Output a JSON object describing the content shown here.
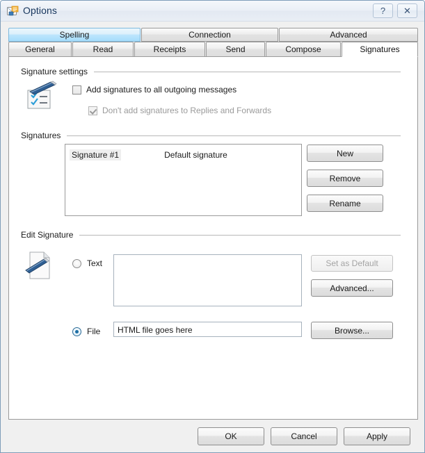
{
  "window": {
    "title": "Options",
    "icon": "mail-options-icon",
    "help_button": "?",
    "close_button": "✕"
  },
  "tabs": {
    "row1": [
      {
        "label": "Spelling",
        "state": "hover"
      },
      {
        "label": "Connection",
        "state": "normal"
      },
      {
        "label": "Advanced",
        "state": "normal"
      }
    ],
    "row2": [
      {
        "label": "General",
        "state": "normal"
      },
      {
        "label": "Read",
        "state": "normal"
      },
      {
        "label": "Receipts",
        "state": "normal"
      },
      {
        "label": "Send",
        "state": "normal"
      },
      {
        "label": "Compose",
        "state": "normal"
      },
      {
        "label": "Signatures",
        "state": "active"
      }
    ]
  },
  "signature_settings": {
    "group_label": "Signature settings",
    "icon": "signature-pen-card-icon",
    "add_to_all": {
      "label": "Add signatures to all outgoing messages",
      "checked": false,
      "enabled": true
    },
    "dont_add_replies": {
      "label": "Don't add signatures to Replies and Forwards",
      "checked": true,
      "enabled": false
    }
  },
  "signatures": {
    "group_label": "Signatures",
    "items": [
      {
        "name": "Signature #1",
        "meta": "Default signature",
        "selected": true
      }
    ],
    "buttons": {
      "new": "New",
      "remove": "Remove",
      "rename": "Rename"
    }
  },
  "edit_signature": {
    "group_label": "Edit Signature",
    "icon": "signature-pen-document-icon",
    "text_option": {
      "label": "Text",
      "selected": false,
      "value": ""
    },
    "file_option": {
      "label": "File",
      "selected": true,
      "value": "HTML file goes here"
    },
    "buttons": {
      "set_as_default": {
        "label": "Set as Default",
        "enabled": false
      },
      "advanced": {
        "label": "Advanced...",
        "enabled": true
      },
      "browse": {
        "label": "Browse...",
        "enabled": true
      }
    }
  },
  "footer": {
    "ok": "OK",
    "cancel": "Cancel",
    "apply": "Apply"
  },
  "colors": {
    "accent": "#a6ddfb",
    "title_text": "#17365d",
    "dialog_bg": "#f0f0f0",
    "panel_bg": "#ffffff",
    "radio_dot": "#1d6fa5"
  }
}
